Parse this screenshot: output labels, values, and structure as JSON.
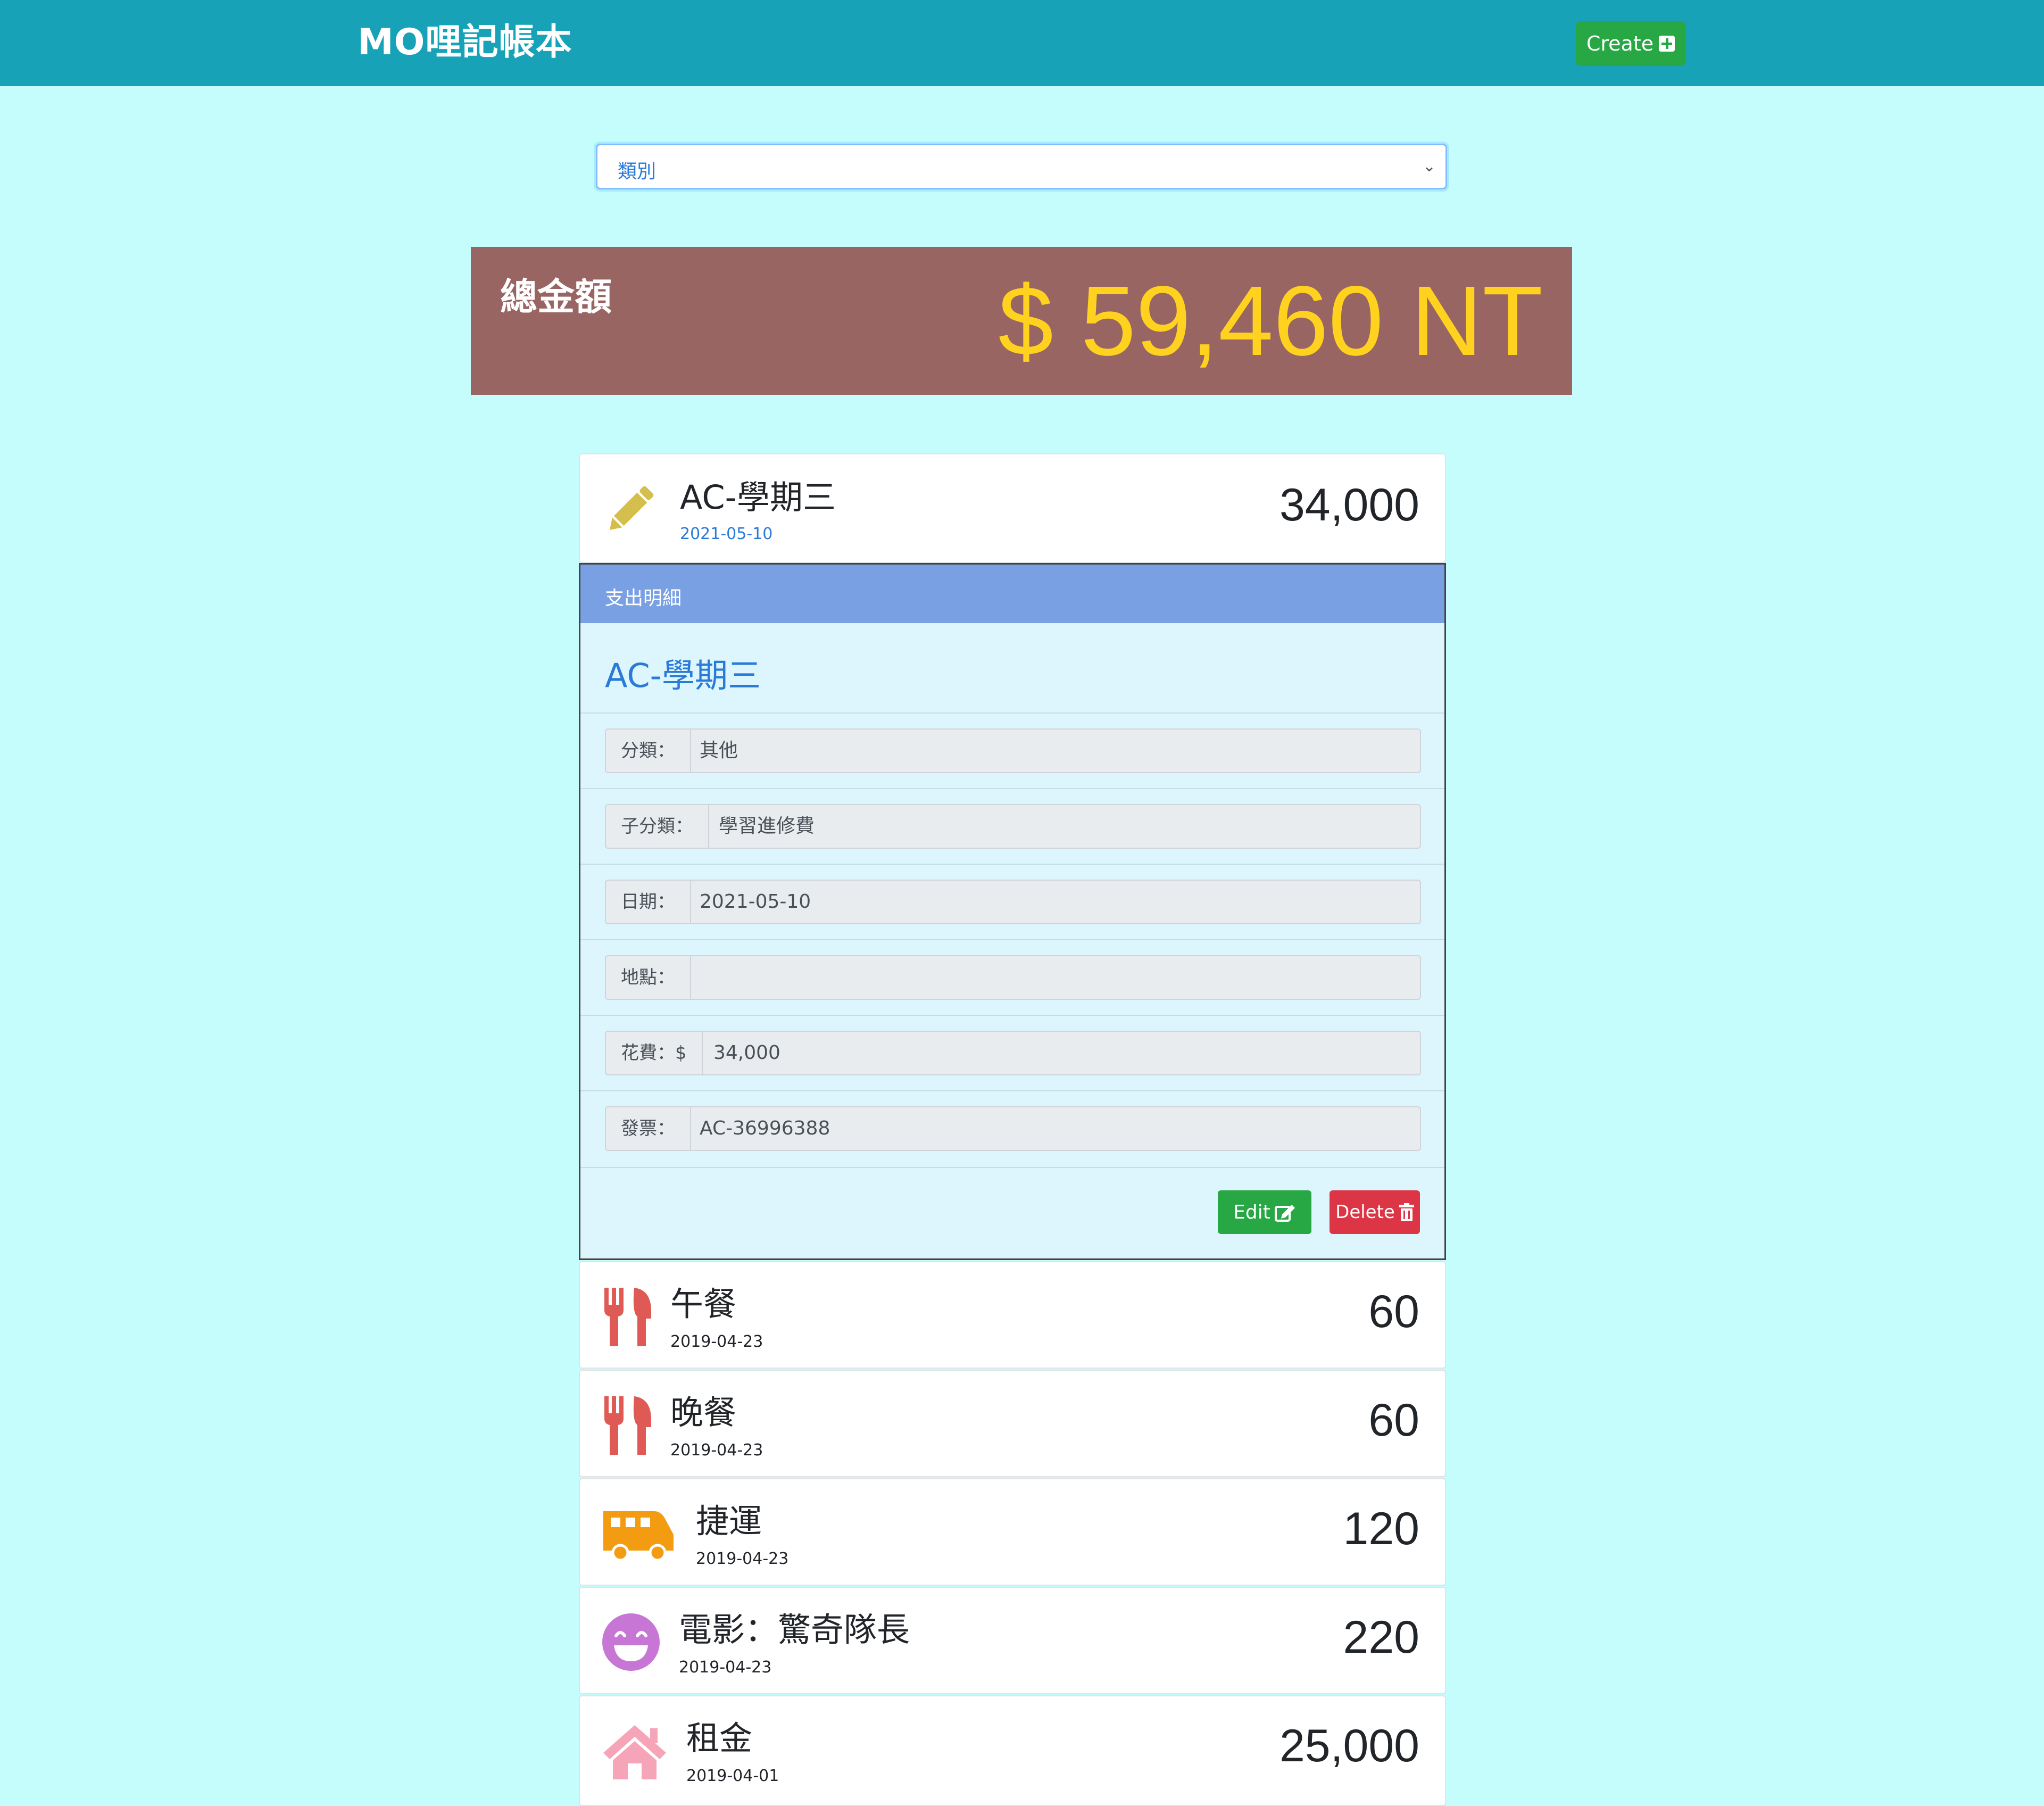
{
  "navbar": {
    "brand": "MO哩記帳本",
    "create_label": "Create"
  },
  "filter": {
    "selected": "類別"
  },
  "total": {
    "label": "總金額",
    "amount": "$ 59,460 NT"
  },
  "records": [
    {
      "title": "AC-學期三",
      "date": "2021-05-10",
      "amount": "34,000",
      "icon": "pencil-icon",
      "color": "#d4be4c"
    },
    {
      "title": "午餐",
      "date": "2019-04-23",
      "amount": "60",
      "icon": "utensils-icon",
      "color": "#e05a55"
    },
    {
      "title": "晚餐",
      "date": "2019-04-23",
      "amount": "60",
      "icon": "utensils-icon",
      "color": "#e05a55"
    },
    {
      "title": "捷運",
      "date": "2019-04-23",
      "amount": "120",
      "icon": "bus-icon",
      "color": "#f39c12"
    },
    {
      "title": "電影：驚奇隊長",
      "date": "2019-04-23",
      "amount": "220",
      "icon": "smile-icon",
      "color": "#c876d6"
    },
    {
      "title": "租金",
      "date": "2019-04-01",
      "amount": "25,000",
      "icon": "home-icon",
      "color": "#f6a5b8"
    }
  ],
  "detail": {
    "header": "支出明細",
    "title": "AC-學期三",
    "fields": [
      {
        "label": "分類：",
        "value": "其他"
      },
      {
        "label": "子分類：",
        "value": "學習進修費"
      },
      {
        "label": "日期：",
        "value": "2021-05-10"
      },
      {
        "label": "地點：",
        "value": ""
      },
      {
        "label": "花費：$",
        "value": "34,000"
      },
      {
        "label": "發票：",
        "value": "AC-36996388"
      }
    ],
    "edit_label": "Edit",
    "delete_label": "Delete"
  }
}
